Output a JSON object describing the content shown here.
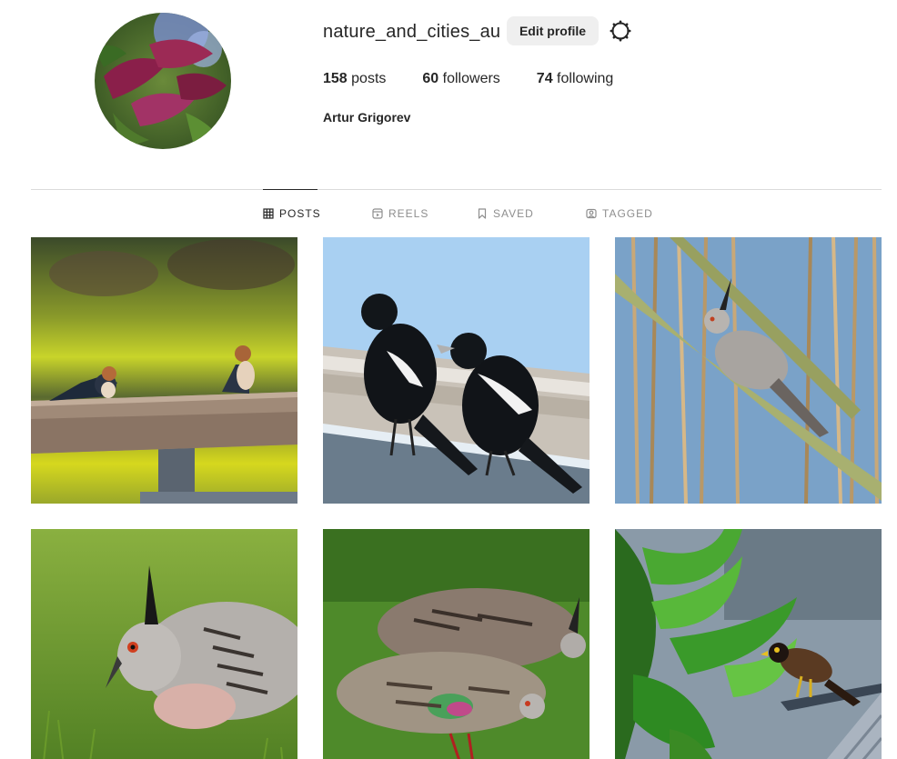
{
  "profile": {
    "username": "nature_and_cities_au",
    "edit_label": "Edit profile",
    "full_name": "Artur Grigorev",
    "avatar_icon": "profile-photo-plant-leaves"
  },
  "stats": {
    "posts_count": "158",
    "posts_label": "posts",
    "followers_count": "60",
    "followers_label": "followers",
    "following_count": "74",
    "following_label": "following"
  },
  "tabs": [
    {
      "label": "POSTS",
      "icon": "grid-icon",
      "active": true
    },
    {
      "label": "REELS",
      "icon": "reels-icon",
      "active": false
    },
    {
      "label": "SAVED",
      "icon": "bookmark-icon",
      "active": false
    },
    {
      "label": "TAGGED",
      "icon": "tagged-icon",
      "active": false
    }
  ],
  "posts": [
    {
      "subject": "two swallows on wooden rail"
    },
    {
      "subject": "two magpies on roof"
    },
    {
      "subject": "crested pigeon on branch"
    },
    {
      "subject": "crested pigeon grazing close-up"
    },
    {
      "subject": "crested pigeons on grass"
    },
    {
      "subject": "myna on gutter with leaves"
    }
  ],
  "colors": {
    "text": "#262626",
    "muted": "#8e8e8e",
    "button_bg": "#efefef",
    "divider": "#dbdbdb"
  }
}
